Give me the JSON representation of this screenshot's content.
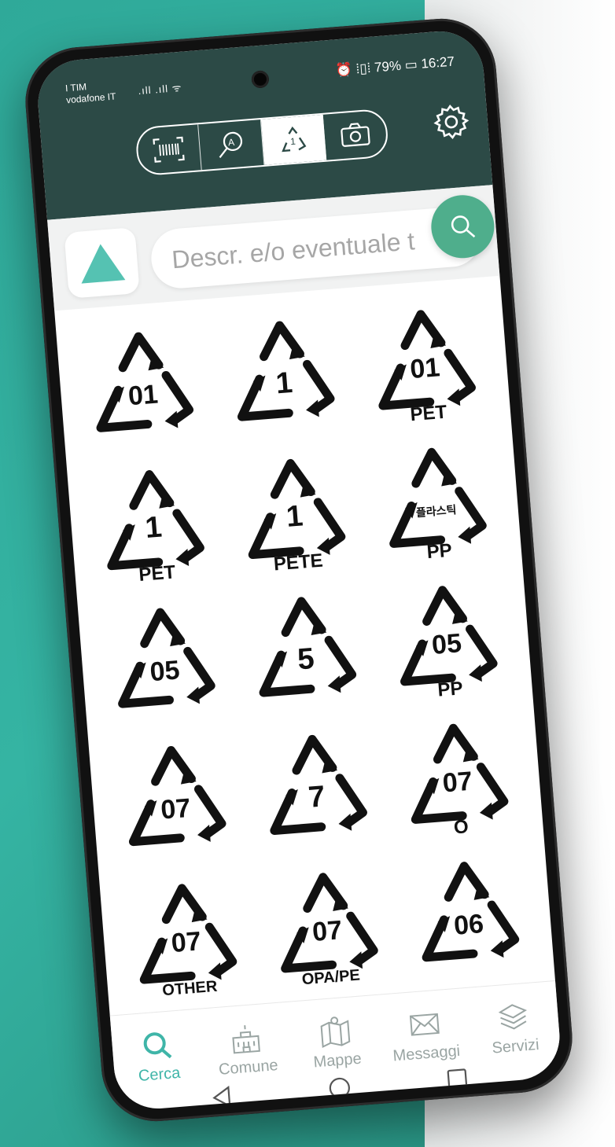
{
  "status_bar": {
    "carrier_line1": "I TIM",
    "carrier_line2": "vodafone IT",
    "signal_text": ".ıll  .ıll ᯤ",
    "right_text": "⏰ ⁞▯⁞ 79% ▭ 16:27"
  },
  "header": {
    "modes": [
      {
        "name": "barcode",
        "icon": "barcode-icon",
        "active": false
      },
      {
        "name": "text-search",
        "icon": "text-search-icon",
        "active": false
      },
      {
        "name": "recycle",
        "icon": "recycle-icon",
        "active": true
      },
      {
        "name": "camera",
        "icon": "camera-icon",
        "active": false
      }
    ],
    "settings_icon": "gear-icon"
  },
  "search": {
    "placeholder": "Descr. e/o eventuale te",
    "value": "",
    "filter_icon": "triangle-icon",
    "button_icon": "search-icon"
  },
  "symbols": [
    {
      "number": "01",
      "label": ""
    },
    {
      "number": "1",
      "label": ""
    },
    {
      "number": "01",
      "label": "PET"
    },
    {
      "number": "1",
      "label": "PET"
    },
    {
      "number": "1",
      "label": "PETE"
    },
    {
      "number": "플라스틱",
      "label": "PP"
    },
    {
      "number": "05",
      "label": ""
    },
    {
      "number": "5",
      "label": ""
    },
    {
      "number": "05",
      "label": "PP"
    },
    {
      "number": "07",
      "label": ""
    },
    {
      "number": "7",
      "label": ""
    },
    {
      "number": "07",
      "label": "O"
    },
    {
      "number": "07",
      "label": "OTHER"
    },
    {
      "number": "07",
      "label": "OPA/PE"
    },
    {
      "number": "06",
      "label": ""
    }
  ],
  "bottom_nav": [
    {
      "label": "Cerca",
      "icon": "search-icon",
      "active": true
    },
    {
      "label": "Comune",
      "icon": "town-hall-icon",
      "active": false
    },
    {
      "label": "Mappe",
      "icon": "map-icon",
      "active": false
    },
    {
      "label": "Messaggi",
      "icon": "mail-icon",
      "active": false
    },
    {
      "label": "Servizi",
      "icon": "layers-icon",
      "active": false
    }
  ],
  "system_nav": [
    "back-icon",
    "home-icon",
    "recents-icon"
  ],
  "colors": {
    "header_bg": "#2c4a46",
    "accent": "#4fae8c",
    "active_nav": "#3fb5a8",
    "background_teal": "#35b4a3"
  }
}
